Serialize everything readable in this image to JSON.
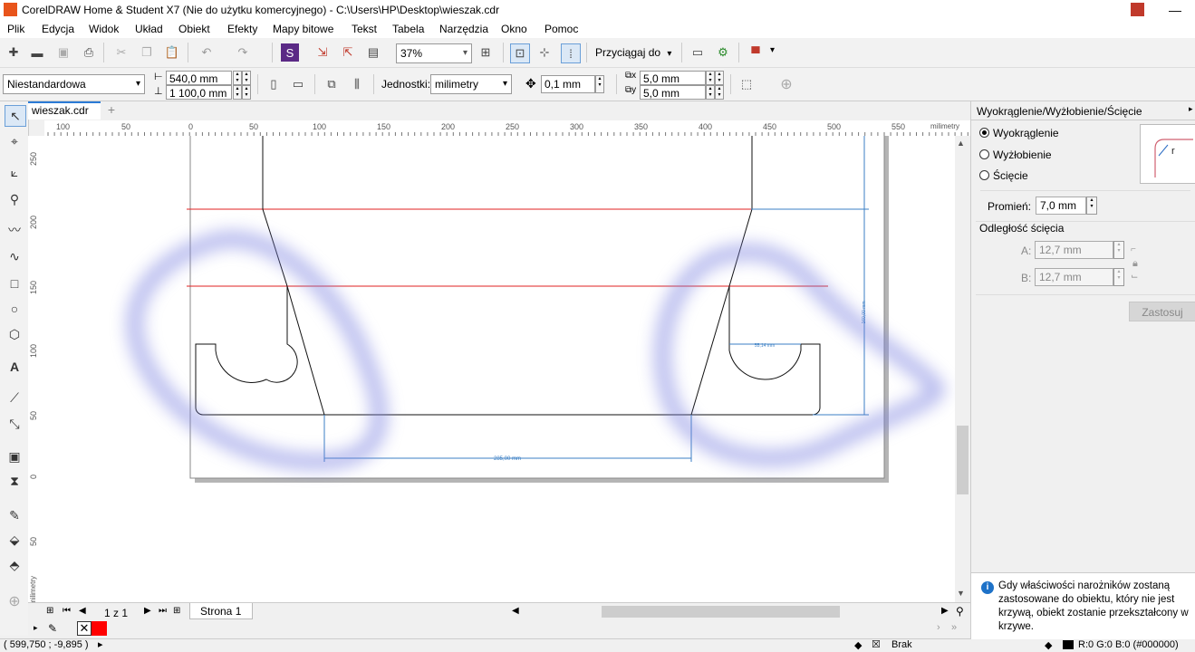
{
  "window": {
    "title": "CorelDRAW Home & Student X7 (Nie do użytku komercyjnego) - C:\\Users\\HP\\Desktop\\wieszak.cdr",
    "controls": [
      "—",
      "❐",
      "✕"
    ]
  },
  "menu": [
    "Plik",
    "Edycja",
    "Widok",
    "Układ",
    "Obiekt",
    "Efekty",
    "Mapy bitowe",
    "Tekst",
    "Tabela",
    "Narzędzia",
    "Okno",
    "Pomoc"
  ],
  "toolbar1": {
    "zoom": "37%",
    "snap_label": "Przyciągaj do"
  },
  "toolbar2": {
    "page_preset": "Niestandardowa",
    "width": "540,0 mm",
    "height": "1 100,0 mm",
    "units_label": "Jednostki:",
    "units_value": "milimetry",
    "nudge": "0,1 mm",
    "dup_x": "5,0 mm",
    "dup_y": "5,0 mm"
  },
  "document": {
    "tab_name": "wieszak.cdr",
    "page_counter": "1 z 1",
    "page_tab": "Strona 1"
  },
  "ruler": {
    "h_ticks": [
      "100",
      "50",
      "0",
      "50",
      "100",
      "150",
      "200",
      "250",
      "300",
      "350",
      "400",
      "450",
      "500",
      "550"
    ],
    "h_unit": "milimetry",
    "v_ticks": [
      "250",
      "200",
      "150",
      "100",
      "50",
      "0",
      "50"
    ],
    "v_unit": "milimetry"
  },
  "drawing": {
    "dim_bottom": "285,00 mm",
    "dim_inner": "55,14 mm",
    "dim_right": "160,00 mm"
  },
  "colors": {
    "accent": "#2b7bd6",
    "guide_red": "#e02020",
    "dimension_blue": "#3b7fc4",
    "highlight_blur": "#7b82e0",
    "fill_swatch": "#ff0000"
  },
  "docker": {
    "title": "Wyokrąglenie/Wyżłobienie/Ścięcie",
    "options": [
      "Wyokrąglenie",
      "Wyżłobienie",
      "Ścięcie"
    ],
    "selected": "Wyokrąglenie",
    "radius_label": "Promień:",
    "radius_value": "7,0 mm",
    "chamfer_label": "Odległość ścięcia",
    "a_label": "A:",
    "a_value": "12,7 mm",
    "b_label": "B:",
    "b_value": "12,7 mm",
    "apply": "Zastosuj",
    "info": "Gdy właściwości narożników zostaną zastosowane do obiektu, który nie jest krzywą, obiekt zostanie przekształcony w krzywe.",
    "preview_glyph": "r"
  },
  "status": {
    "coords": "( 599,750 ; -9,895 )",
    "fill_info": "R:0 G:0 B:0 (#000000)",
    "curve_info": "Brak"
  }
}
